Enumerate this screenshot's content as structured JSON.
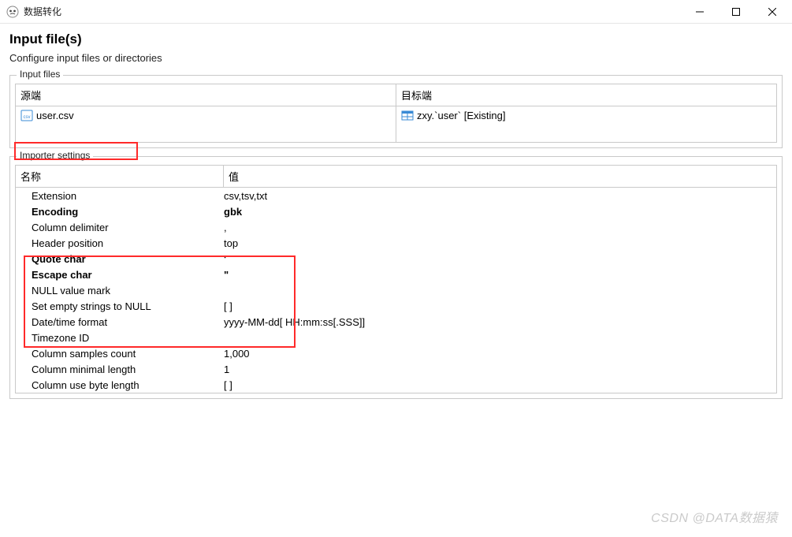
{
  "window": {
    "title": "数据转化"
  },
  "header": {
    "title": "Input file(s)",
    "subtitle": "Configure input files or directories"
  },
  "inputFilesGroup": {
    "label": "Input files",
    "columns": {
      "source": "源端",
      "target": "目标端"
    },
    "row": {
      "source": "user.csv",
      "target": "zxy.`user` [Existing]"
    }
  },
  "importerSettingsGroup": {
    "label": "Importer settings",
    "columns": {
      "name": "名称",
      "value": "值"
    },
    "rows": [
      {
        "name": "Extension",
        "value": "csv,tsv,txt",
        "bold": false
      },
      {
        "name": "Encoding",
        "value": "gbk",
        "bold": true
      },
      {
        "name": "Column delimiter",
        "value": ",",
        "bold": false
      },
      {
        "name": "Header position",
        "value": "top",
        "bold": false
      },
      {
        "name": "Quote char",
        "value": "'",
        "bold": true
      },
      {
        "name": "Escape char",
        "value": "\"",
        "bold": true
      },
      {
        "name": "NULL value mark",
        "value": "",
        "bold": false
      },
      {
        "name": "Set empty strings to NULL",
        "value": "[ ]",
        "bold": false
      },
      {
        "name": "Date/time format",
        "value": "yyyy-MM-dd[ HH:mm:ss[.SSS]]",
        "bold": false
      },
      {
        "name": "Timezone ID",
        "value": "",
        "bold": false
      },
      {
        "name": "Column samples count",
        "value": "1,000",
        "bold": false
      },
      {
        "name": "Column minimal length",
        "value": "1",
        "bold": false
      },
      {
        "name": "Column use byte length",
        "value": "[ ]",
        "bold": false
      }
    ]
  },
  "watermark": "CSDN @DATA数据猿"
}
